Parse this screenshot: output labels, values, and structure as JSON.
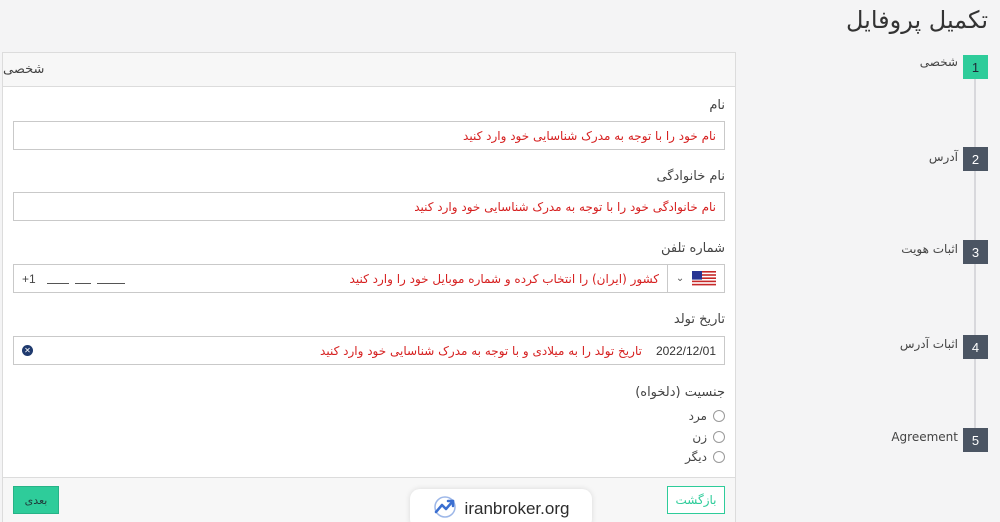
{
  "page": {
    "title": "تکمیل پروفایل"
  },
  "stepper": {
    "steps": [
      {
        "num": "1",
        "label": "شخصی",
        "active": true
      },
      {
        "num": "2",
        "label": "آدرس",
        "active": false
      },
      {
        "num": "3",
        "label": "اثبات هویت",
        "active": false
      },
      {
        "num": "4",
        "label": "اثبات آدرس",
        "active": false
      },
      {
        "num": "5",
        "label": "Agreement",
        "active": false
      }
    ]
  },
  "form": {
    "section_title": "شخصی",
    "first_name": {
      "label": "نام",
      "placeholder": "نام خود را با توجه به مدرک شناسایی خود وارد کنید"
    },
    "last_name": {
      "label": "نام خانوادگی",
      "placeholder": "نام خانوادگی خود را با توجه به مدرک شناسایی خود وارد کنید"
    },
    "phone": {
      "label": "شماره تلفن",
      "placeholder": "کشور (ایران) را انتخاب کرده و شماره موبایل خود را وارد کنید",
      "prefix": "+1",
      "flag_icon": "us-flag-icon"
    },
    "birth_date": {
      "label": "تاریخ تولد",
      "value": "2022/12/01",
      "placeholder": "تاریخ تولد را به میلادی و با توجه به مدرک شناسایی خود وارد کنید"
    },
    "gender": {
      "label": "جنسیت (دلخواه)",
      "options": [
        "مرد",
        "زن",
        "دیگر"
      ]
    },
    "buttons": {
      "next": "بعدی",
      "back": "بازگشت"
    }
  },
  "watermark": {
    "text": "iranbroker.org"
  },
  "colors": {
    "accent": "#2ecc9a",
    "error": "#d62020",
    "step_bg": "#4b5563"
  }
}
